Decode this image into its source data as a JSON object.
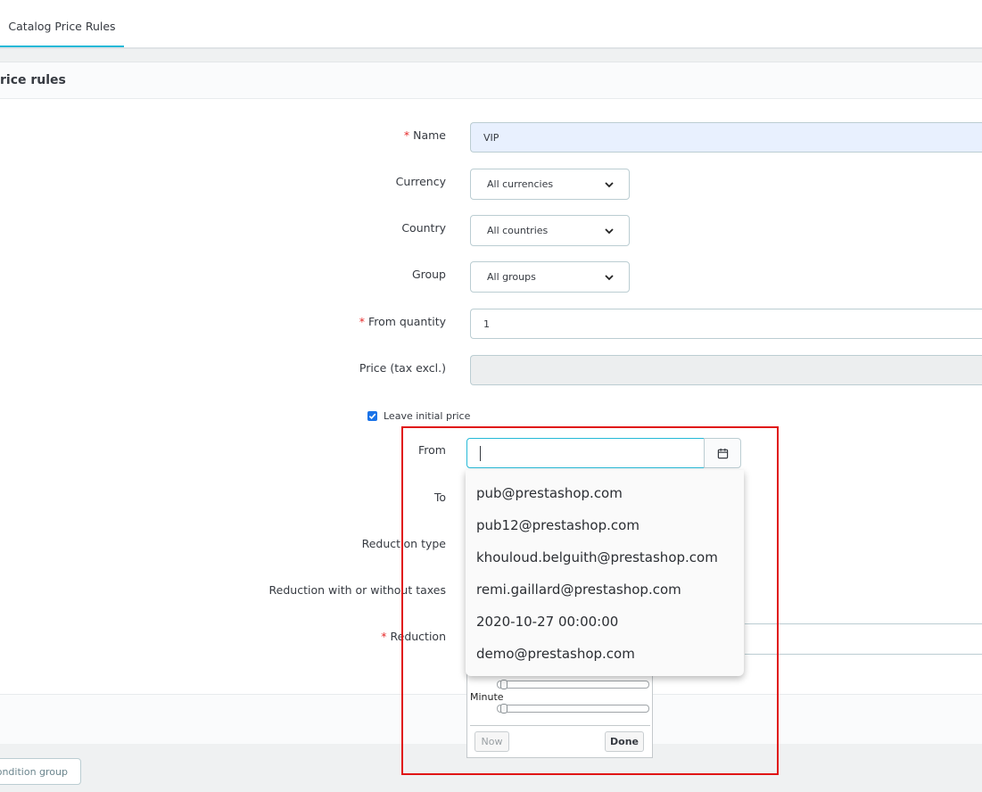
{
  "tabs": {
    "active_label": "Catalog Price Rules"
  },
  "panel": {
    "title": "rice rules"
  },
  "form": {
    "name": {
      "label": "Name",
      "value": "VIP"
    },
    "currency": {
      "label": "Currency",
      "selected": "All currencies"
    },
    "country": {
      "label": "Country",
      "selected": "All countries"
    },
    "group": {
      "label": "Group",
      "selected": "All groups"
    },
    "from_quantity": {
      "label": "From quantity",
      "value": "1"
    },
    "price": {
      "label": "Price (tax excl.)",
      "value": ""
    },
    "leave_initial_price": {
      "label": "Leave initial price",
      "checked": true
    },
    "from": {
      "label": "From",
      "value": ""
    },
    "to": {
      "label": "To"
    },
    "reduction_type": {
      "label": "Reduction type"
    },
    "reduction_tax": {
      "label": "Reduction with or without taxes"
    },
    "reduction": {
      "label": "Reduction"
    },
    "required_marker": "*"
  },
  "autocomplete": {
    "items": [
      "pub@prestashop.com",
      "pub12@prestashop.com",
      "khouloud.belguith@prestashop.com",
      "remi.gaillard@prestashop.com",
      "2020-10-27 00:00:00",
      "demo@prestashop.com"
    ]
  },
  "timepicker": {
    "minute_label": "Minute",
    "now_label": "Now",
    "done_label": "Done"
  },
  "footer": {
    "condition_group_button": "ondition group"
  },
  "colors": {
    "accent": "#25b9d7",
    "required": "#e62a2a",
    "highlight_box": "#e01515",
    "autofill": "#e8f0fe"
  },
  "icons": {
    "calendar": "calendar-icon",
    "select": "chevron-down-icon",
    "check": "check-icon"
  }
}
